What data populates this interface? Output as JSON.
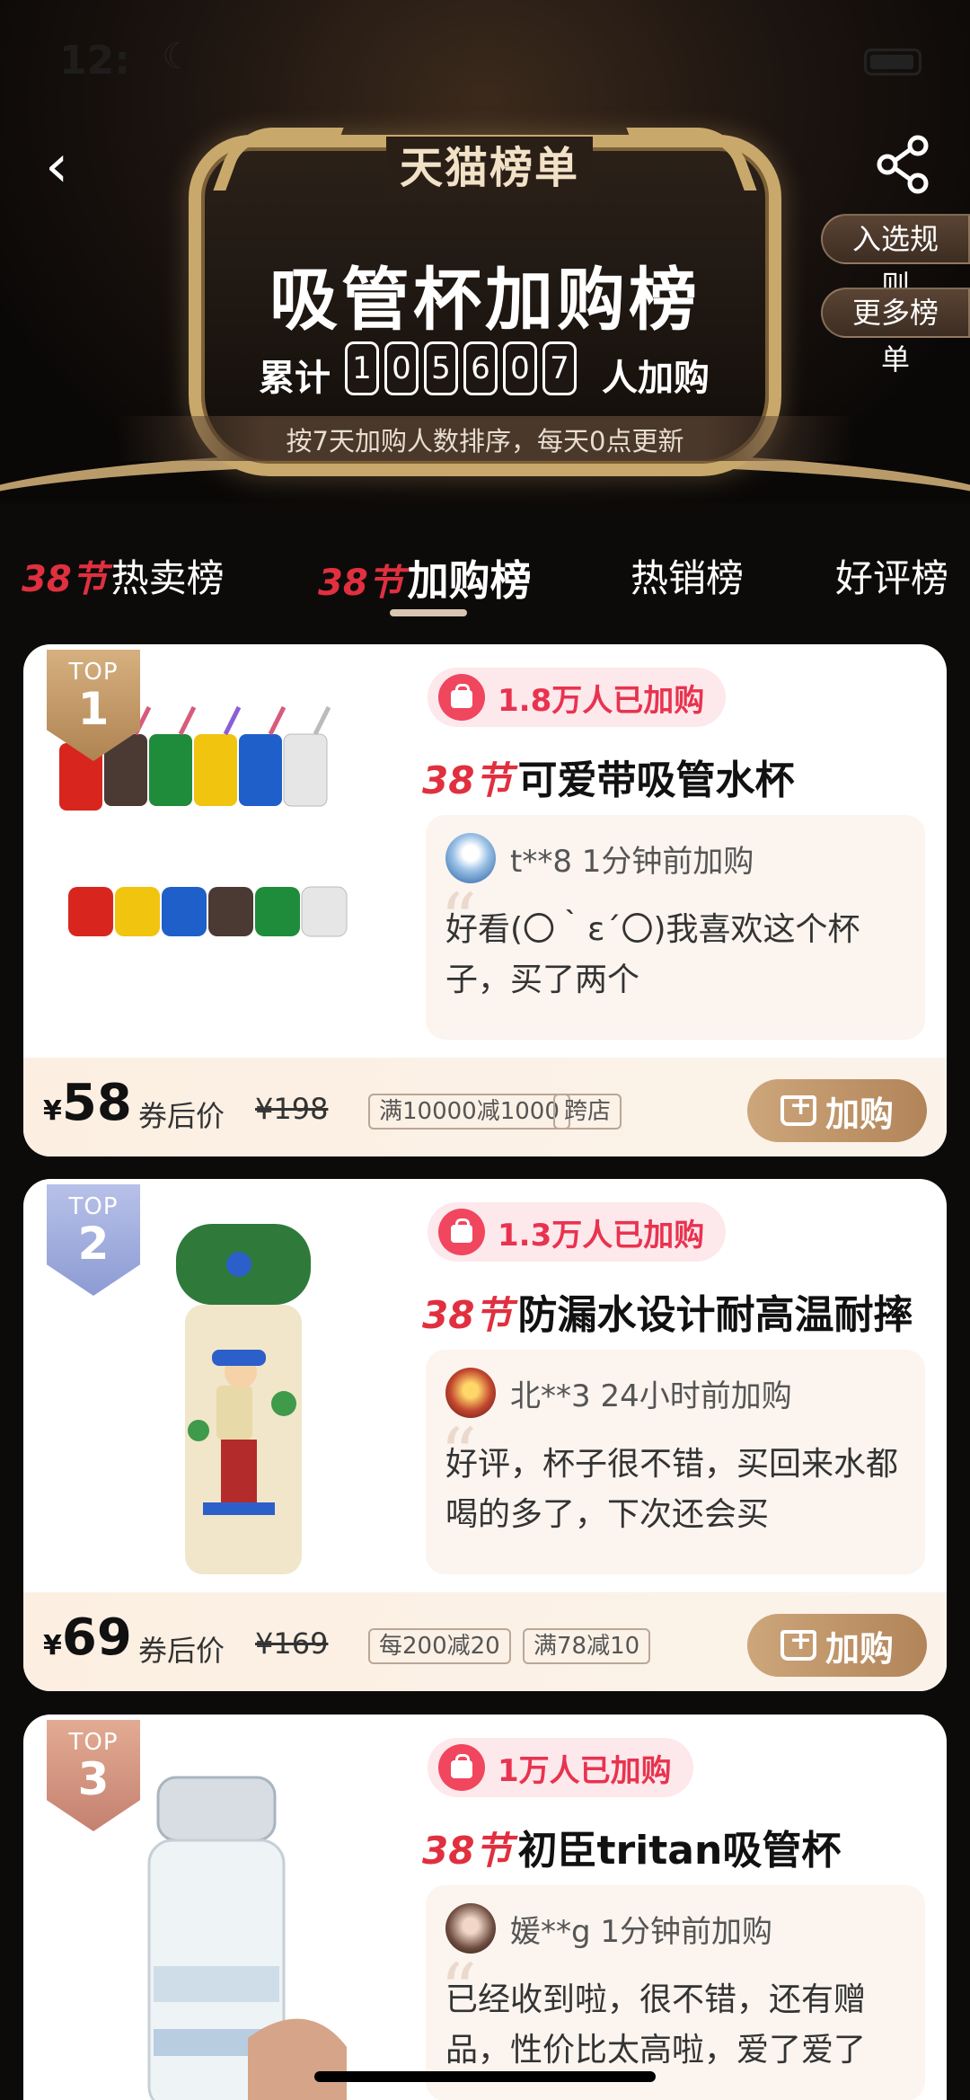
{
  "status": {
    "time": "12:"
  },
  "header": {
    "logo": "天猫榜单",
    "title": "吸管杯加购榜",
    "counter_pre": "累计",
    "counter_digits": [
      "1",
      "0",
      "5",
      "6",
      "0",
      "7"
    ],
    "counter_post": "人加购",
    "subline": "按7天加购人数排序，每天0点更新",
    "rules_label": "入选规则",
    "more_label": "更多榜单"
  },
  "tabs": [
    {
      "fest": "38节",
      "label": "热卖榜"
    },
    {
      "fest": "38节",
      "label": "加购榜"
    },
    {
      "label": "热销榜"
    },
    {
      "label": "好评榜"
    }
  ],
  "products": [
    {
      "badge_top": "TOP",
      "rank": "1",
      "added": "1.8万人已加购",
      "fest": "38节",
      "title": "可爱带吸管水杯",
      "review_user": "t**8 1分钟前加购",
      "review_text": "好看(〇｀ε´〇)我喜欢这个杯子，买了两个",
      "yen": "¥",
      "price": "58",
      "after_label": "券后价",
      "orig_price": "¥198",
      "tags": [
        "满10000减1000",
        "跨店"
      ],
      "button": "加购"
    },
    {
      "badge_top": "TOP",
      "rank": "2",
      "added": "1.3万人已加购",
      "fest": "38节",
      "title": "防漏水设计耐高温耐摔",
      "review_user": "北**3 24小时前加购",
      "review_text": "好评，杯子很不错，买回来水都喝的多了，下次还会买",
      "yen": "¥",
      "price": "69",
      "after_label": "券后价",
      "orig_price": "¥169",
      "tags": [
        "每200减20",
        "满78减10"
      ],
      "button": "加购"
    },
    {
      "badge_top": "TOP",
      "rank": "3",
      "added": "1万人已加购",
      "fest": "38节",
      "title": "初臣tritan吸管杯",
      "review_user": "媛**g 1分钟前加购",
      "review_text": "已经收到啦，很不错，还有赠品，性价比太高啦，爱了爱了"
    }
  ],
  "colors": {
    "accent_red": "#e0303f",
    "gold": "#c9a86b",
    "button_gold": "#b28459"
  },
  "icons": [
    "back-icon",
    "share-icon",
    "bag-icon",
    "cart-icon",
    "moon-icon",
    "battery-icon"
  ]
}
